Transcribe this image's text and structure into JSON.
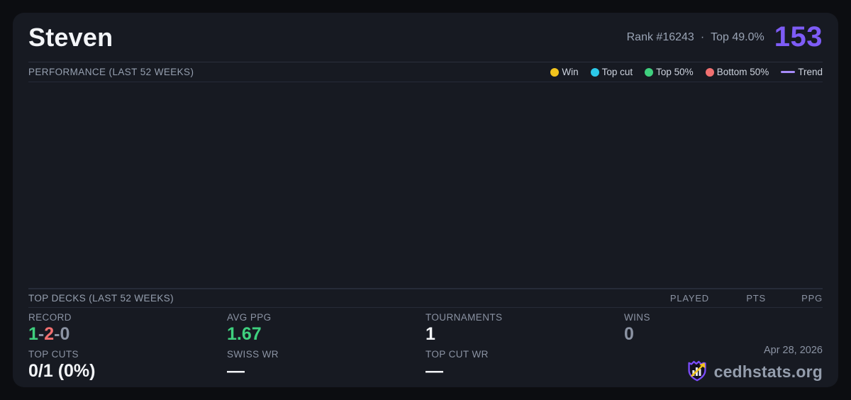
{
  "header": {
    "player_name": "Steven",
    "rank": "Rank #16243",
    "separator": "·",
    "top_percent": "Top 49.0%",
    "score": "153",
    "score_color": "#7e5cf6"
  },
  "performance": {
    "title": "PERFORMANCE (LAST 52 WEEKS)",
    "legend": [
      {
        "label": "Win",
        "color": "#f2c41d",
        "mark": "dot"
      },
      {
        "label": "Top cut",
        "color": "#2cc8e8",
        "mark": "dot"
      },
      {
        "label": "Top 50%",
        "color": "#3fd07e",
        "mark": "dot"
      },
      {
        "label": "Bottom 50%",
        "color": "#f17070",
        "mark": "dot"
      },
      {
        "label": "Trend",
        "color": "#a78bfa",
        "mark": "line"
      }
    ]
  },
  "chart_data": {
    "type": "scatter",
    "title": "PERFORMANCE (LAST 52 WEEKS)",
    "points": [],
    "note": "chart plot area is empty in the screenshot"
  },
  "top_decks": {
    "title": "TOP DECKS (LAST 52 WEEKS)",
    "columns": [
      "PLAYED",
      "PTS",
      "PPG"
    ],
    "rows": []
  },
  "stats": {
    "record": {
      "label": "RECORD",
      "wins": "1",
      "losses": "2",
      "draws": "0",
      "sep": "-"
    },
    "avg_ppg": {
      "label": "AVG PPG",
      "value": "1.67"
    },
    "tournaments": {
      "label": "TOURNAMENTS",
      "value": "1"
    },
    "wins": {
      "label": "WINS",
      "value": "0"
    },
    "top_cuts": {
      "label": "TOP CUTS",
      "value": "0/1 (0%)"
    },
    "swiss_wr": {
      "label": "SWISS WR",
      "value": "—"
    },
    "top_cut_wr": {
      "label": "TOP CUT WR",
      "value": "—"
    }
  },
  "footer": {
    "date": "Apr 28, 2026",
    "site": "cedhstats.org"
  },
  "colors": {
    "page_bg": "#0c0d11",
    "card_bg": "#171a22",
    "divider": "#262b38",
    "accent_purple": "#7e5cf6",
    "green": "#3fd07e",
    "red": "#f17070",
    "yellow": "#f2c41d",
    "cyan": "#2cc8e8",
    "trend_purple": "#a78bfa"
  }
}
